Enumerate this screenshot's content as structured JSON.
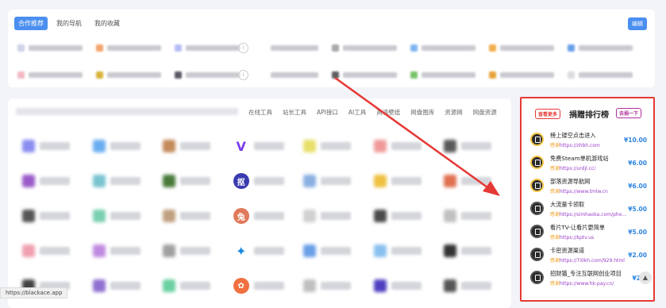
{
  "top": {
    "tabs": [
      {
        "label": "合作推荐",
        "active": true
      },
      {
        "label": "我的导航",
        "active": false
      },
      {
        "label": "我的收藏",
        "active": false
      }
    ],
    "edit_label": "编辑"
  },
  "nav": {
    "items": [
      "在线工具",
      "站长工具",
      "API接口",
      "AI工具",
      "高清壁纸",
      "网盘图库",
      "资源网",
      "网盘资源"
    ]
  },
  "grid_logos": [
    "V",
    "抠",
    "兔",
    "✦",
    "✿"
  ],
  "rank": {
    "more_label": "查看更多",
    "title": "捐赠排行榜",
    "button_label": "去捐一下",
    "items": [
      {
        "name": "榜上镂空点击进入",
        "label": "感谢",
        "url": "https://zhbh.com",
        "amount": "¥10.00"
      },
      {
        "name": "免费Steam单机游戏站",
        "label": "感谢",
        "url": "https://urdjl.cc/",
        "amount": "¥6.00"
      },
      {
        "name": "部落资源导航网",
        "label": "感谢",
        "url": "https://www.tmlw.cn",
        "amount": "¥6.00"
      },
      {
        "name": "大流量卡领取",
        "label": "感谢",
        "url": "https://simhaoka.com/pho...",
        "amount": "¥5.00"
      },
      {
        "name": "看片TV-让看片更简单",
        "label": "感谢",
        "url": "https://kptv.us",
        "amount": "¥5.00"
      },
      {
        "name": "卡密资源渠道",
        "label": "感谢",
        "url": "https://7i0kh.com/929.html",
        "amount": "¥2.00"
      },
      {
        "name": "招财猫_专注互联网创业项目",
        "label": "感谢",
        "url": "https://www.hk-pay.cn/",
        "amount": "¥2.0"
      }
    ]
  },
  "status_url": "https://blackace.app",
  "scroll_top_icon": "arrow-up-icon",
  "colors": {
    "accent": "#4a8ff0",
    "highlight": "#e53935",
    "amount": "#2f86e0",
    "link": "#9b3dc9"
  }
}
